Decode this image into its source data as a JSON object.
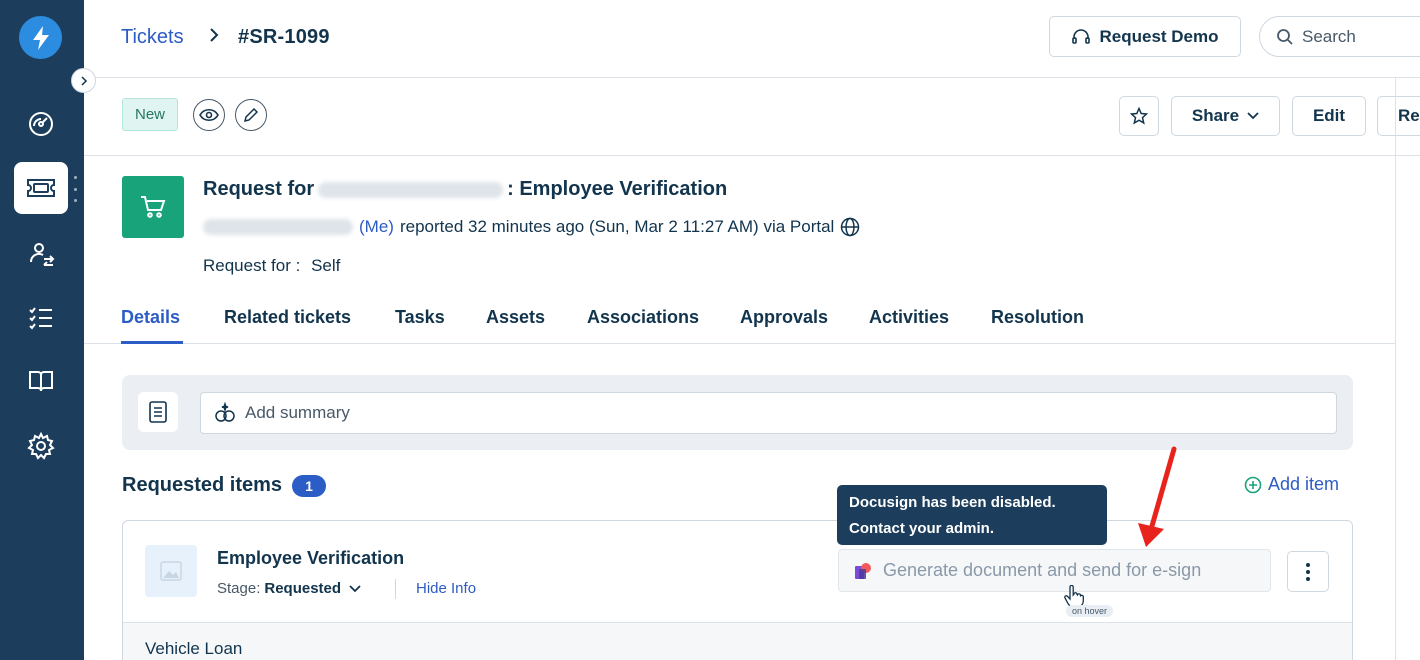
{
  "breadcrumb": {
    "link": "Tickets",
    "current": "#SR-1099"
  },
  "header": {
    "request_demo": "Request Demo",
    "search_placeholder": "Search"
  },
  "subbar": {
    "status": "New",
    "share": "Share",
    "edit": "Edit",
    "cut_button": "Re"
  },
  "request": {
    "title_prefix": "Request for",
    "title_suffix": ": Employee Verification",
    "me_label": "(Me)",
    "reported_text": "reported 32 minutes ago (Sun, Mar 2 11:27 AM) via Portal",
    "request_for_label": "Request for :",
    "request_for_value": "Self"
  },
  "tabs": [
    "Details",
    "Related tickets",
    "Tasks",
    "Assets",
    "Associations",
    "Approvals",
    "Activities",
    "Resolution"
  ],
  "summary": {
    "placeholder": "Add summary"
  },
  "requested_items": {
    "title": "Requested items",
    "count": "1",
    "add_item": "Add item",
    "item": {
      "name": "Employee Verification",
      "stage_label": "Stage:",
      "stage_value": "Requested",
      "hide_info": "Hide Info",
      "generate_button": "Generate document and send for e-sign",
      "detail_value": "Vehicle Loan"
    }
  },
  "tooltip": {
    "line1": "Docusign has been disabled.",
    "line2": "Contact your admin."
  },
  "annotation": {
    "hover_tag": "on hover"
  },
  "colors": {
    "sidebar": "#1c3e5c",
    "accent": "#2c5cc5",
    "request_icon": "#18a37a",
    "annotation_arrow": "#e8231c"
  }
}
